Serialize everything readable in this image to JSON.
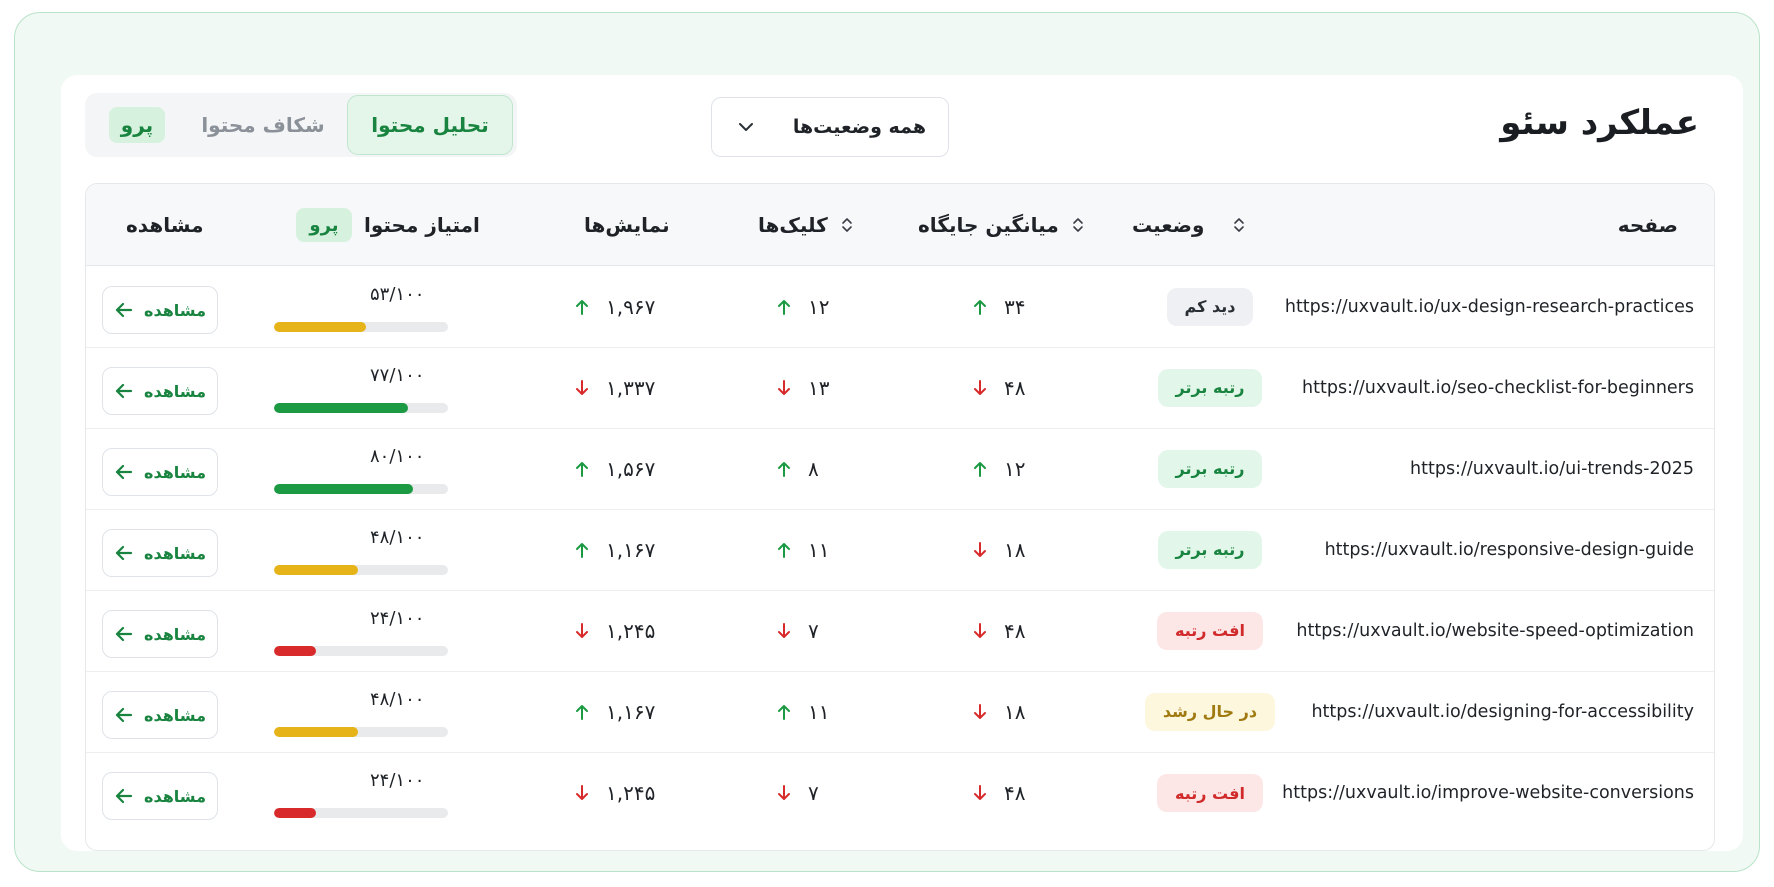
{
  "header": {
    "title": "عملکرد سئو",
    "status_filter": "همه وضعیت‌ها",
    "tabs": {
      "analysis": "تحلیل محتوا",
      "explorer": "شکاف محتوا",
      "pro": "پرو"
    }
  },
  "table": {
    "columns": {
      "page": "صفحه",
      "status": "وضعیت",
      "avg_position": "میانگین جایگاه",
      "clicks": "کلیک‌ها",
      "impressions": "نمایش‌ها",
      "score": "امتیاز محتوا",
      "score_badge": "پرو",
      "view": "مشاهده"
    },
    "view_label": "مشاهده",
    "rows": [
      {
        "url": "https://uxvault.io/ux-design-research-practices",
        "status": "دید کم",
        "status_type": "neutral",
        "position": "۳۴",
        "position_dir": "up",
        "clicks": "۱۲",
        "clicks_dir": "up",
        "impressions": "۱,۹۶۷",
        "impressions_dir": "up",
        "score": "۵۳/۱۰۰",
        "score_value": 53,
        "score_color": "#e6b319"
      },
      {
        "url": "https://uxvault.io/seo-checklist-for-beginners",
        "status": "رتبه برتر",
        "status_type": "good",
        "position": "۴۸",
        "position_dir": "down",
        "clicks": "۱۳",
        "clicks_dir": "down",
        "impressions": "۱,۳۳۷",
        "impressions_dir": "down",
        "score": "۷۷/۱۰۰",
        "score_value": 77,
        "score_color": "#1b9a43"
      },
      {
        "url": "https://uxvault.io/ui-trends-2025",
        "status": "رتبه برتر",
        "status_type": "good",
        "position": "۱۲",
        "position_dir": "up",
        "clicks": "۸",
        "clicks_dir": "up",
        "impressions": "۱,۵۶۷",
        "impressions_dir": "up",
        "score": "۸۰/۱۰۰",
        "score_value": 80,
        "score_color": "#1b9a43"
      },
      {
        "url": "https://uxvault.io/responsive-design-guide",
        "status": "رتبه برتر",
        "status_type": "good",
        "position": "۱۸",
        "position_dir": "down",
        "clicks": "۱۱",
        "clicks_dir": "up",
        "impressions": "۱,۱۶۷",
        "impressions_dir": "up",
        "score": "۴۸/۱۰۰",
        "score_value": 48,
        "score_color": "#e6b319"
      },
      {
        "url": "https://uxvault.io/website-speed-optimization",
        "status": "افت رتبه",
        "status_type": "bad",
        "position": "۴۸",
        "position_dir": "down",
        "clicks": "۷",
        "clicks_dir": "down",
        "impressions": "۱,۲۴۵",
        "impressions_dir": "down",
        "score": "۲۴/۱۰۰",
        "score_value": 24,
        "score_color": "#d82a2a"
      },
      {
        "url": "https://uxvault.io/designing-for-accessibility",
        "status": "در حال رشد",
        "status_type": "grow",
        "position": "۱۸",
        "position_dir": "down",
        "clicks": "۱۱",
        "clicks_dir": "up",
        "impressions": "۱,۱۶۷",
        "impressions_dir": "up",
        "score": "۴۸/۱۰۰",
        "score_value": 48,
        "score_color": "#e6b319"
      },
      {
        "url": "https://uxvault.io/improve-website-conversions",
        "status": "افت رتبه",
        "status_type": "bad",
        "position": "۴۸",
        "position_dir": "down",
        "clicks": "۷",
        "clicks_dir": "down",
        "impressions": "۱,۲۴۵",
        "impressions_dir": "down",
        "score": "۲۴/۱۰۰",
        "score_value": 24,
        "score_color": "#d82a2a"
      }
    ]
  },
  "colors": {
    "accent": "#18843f",
    "up_arrow": "#1b9a43",
    "down_arrow": "#d82a2a"
  }
}
